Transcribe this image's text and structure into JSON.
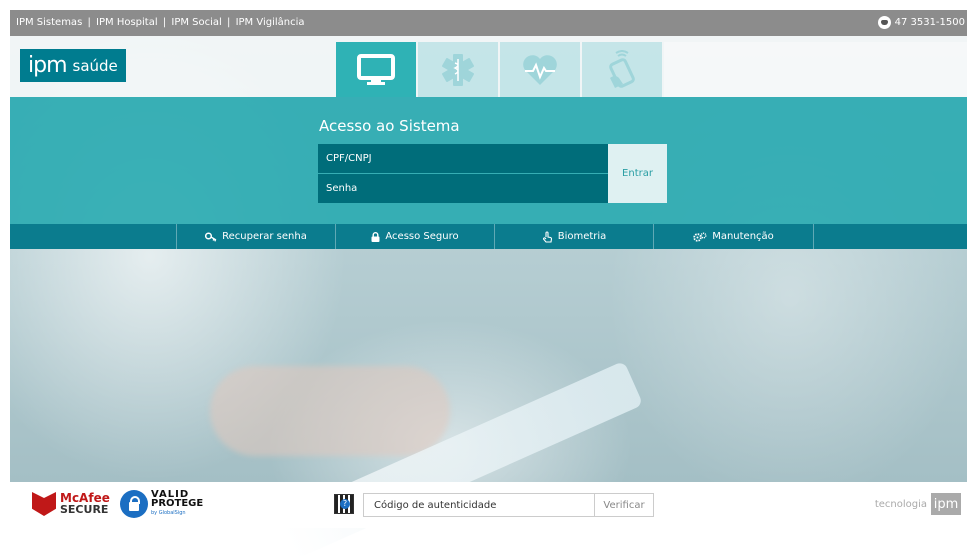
{
  "topbar": {
    "links": [
      "IPM Sistemas",
      "IPM Hospital",
      "IPM Social",
      "IPM Vigilância"
    ],
    "separator": "|",
    "phone": "47 3531-1500"
  },
  "header": {
    "logo_brand": "ipm",
    "logo_product": "saúde",
    "tabs": [
      {
        "icon": "monitor-icon",
        "active": true
      },
      {
        "icon": "medical-star-icon",
        "active": false
      },
      {
        "icon": "heartbeat-icon",
        "active": false
      },
      {
        "icon": "mobile-touch-icon",
        "active": false
      }
    ]
  },
  "login": {
    "title": "Acesso ao Sistema",
    "cpf_placeholder": "CPF/CNPJ",
    "senha_placeholder": "Senha",
    "submit_label": "Entrar"
  },
  "actions": [
    {
      "icon": "key-icon",
      "label": "Recuperar senha"
    },
    {
      "icon": "lock-icon",
      "label": "Acesso Seguro"
    },
    {
      "icon": "hand-pointer-icon",
      "label": "Biometria"
    },
    {
      "icon": "gears-icon",
      "label": "Manutenção"
    }
  ],
  "footer": {
    "mcafee_line1": "McAfee",
    "mcafee_line2": "SECURE",
    "valid_line1": "VALID",
    "valid_line2": "PROTEGE",
    "valid_line3": "by GlobalSign",
    "auth_placeholder": "Código de autenticidade",
    "verify_label": "Verificar",
    "brand_text": "tecnologia",
    "brand_logo": "ipm"
  },
  "colors": {
    "teal": "#2fb2b5",
    "dark_teal": "#006d7a",
    "nav_teal": "#0b7c8e",
    "logo_teal": "#007c8f"
  }
}
